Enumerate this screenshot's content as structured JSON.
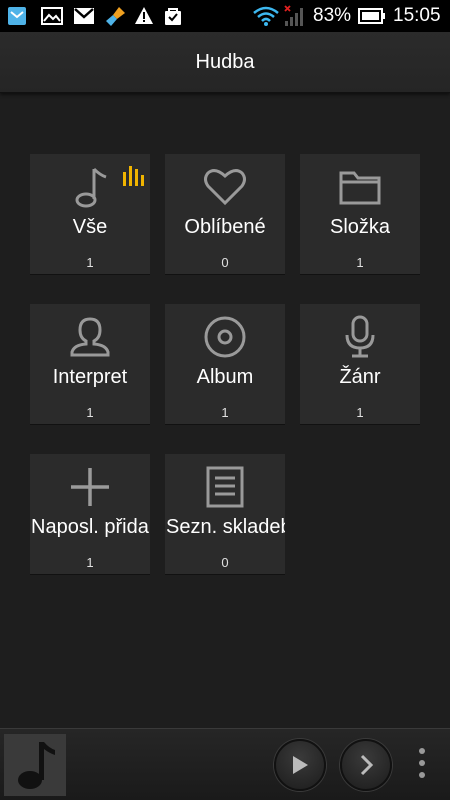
{
  "status_bar": {
    "battery_percent": "83%",
    "time": "15:05",
    "notification_icons": [
      "mail-box-icon",
      "image-icon",
      "gmail-icon",
      "cleaner-brush-icon",
      "warning-icon",
      "shopping-bag-check-icon"
    ]
  },
  "header": {
    "title": "Hudba"
  },
  "tiles": [
    {
      "label": "Vše",
      "count": "1",
      "icon": "music-note-icon",
      "playing_indicator": true
    },
    {
      "label": "Oblíbené",
      "count": "0",
      "icon": "heart-icon"
    },
    {
      "label": "Složka",
      "count": "1",
      "icon": "folder-icon"
    },
    {
      "label": "Interpret",
      "count": "1",
      "icon": "person-icon"
    },
    {
      "label": "Album",
      "count": "1",
      "icon": "disc-icon"
    },
    {
      "label": "Žánr",
      "count": "1",
      "icon": "microphone-icon"
    },
    {
      "label": "Naposl. přidané",
      "count": "1",
      "icon": "plus-icon"
    },
    {
      "label": "Sezn. skladeb",
      "count": "0",
      "icon": "playlist-icon"
    }
  ],
  "player": {
    "controls": [
      "play-icon",
      "next-icon",
      "overflow-menu-icon"
    ]
  },
  "colors": {
    "background": "#1e1e1e",
    "tile": "#2b2b2b",
    "icon_gray": "#9a9a9a",
    "accent_playing": "#f0b400"
  }
}
